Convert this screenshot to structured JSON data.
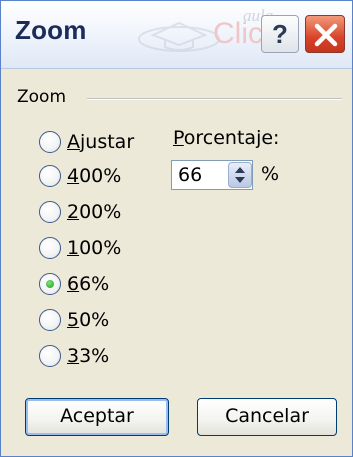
{
  "window": {
    "title": "Zoom",
    "watermark_top": "aula",
    "watermark_bottom": "Clic",
    "help_label": "?"
  },
  "group": {
    "label": "Zoom"
  },
  "radios": [
    {
      "key": "A",
      "rest": "justar",
      "selected": false
    },
    {
      "key": "4",
      "rest": "00%",
      "selected": false
    },
    {
      "key": "2",
      "rest": "00%",
      "selected": false
    },
    {
      "key": "1",
      "rest": "00%",
      "selected": false
    },
    {
      "key": "6",
      "rest": "6%",
      "selected": true
    },
    {
      "key": "5",
      "rest": "0%",
      "selected": false
    },
    {
      "key": "3",
      "rest": "3%",
      "selected": false
    }
  ],
  "percentage": {
    "label_key": "P",
    "label_rest": "orcentaje:",
    "value": "66",
    "unit": "%"
  },
  "buttons": {
    "ok": "Aceptar",
    "cancel": "Cancelar"
  },
  "colors": {
    "dialog_bg": "#ece9d8",
    "close_red": "#d8432a",
    "radio_selected": "#1c9a1c"
  },
  "icons": {
    "help": "question-icon",
    "close": "close-x-icon",
    "spinner_up": "arrow-up-icon",
    "spinner_down": "arrow-down-icon"
  }
}
